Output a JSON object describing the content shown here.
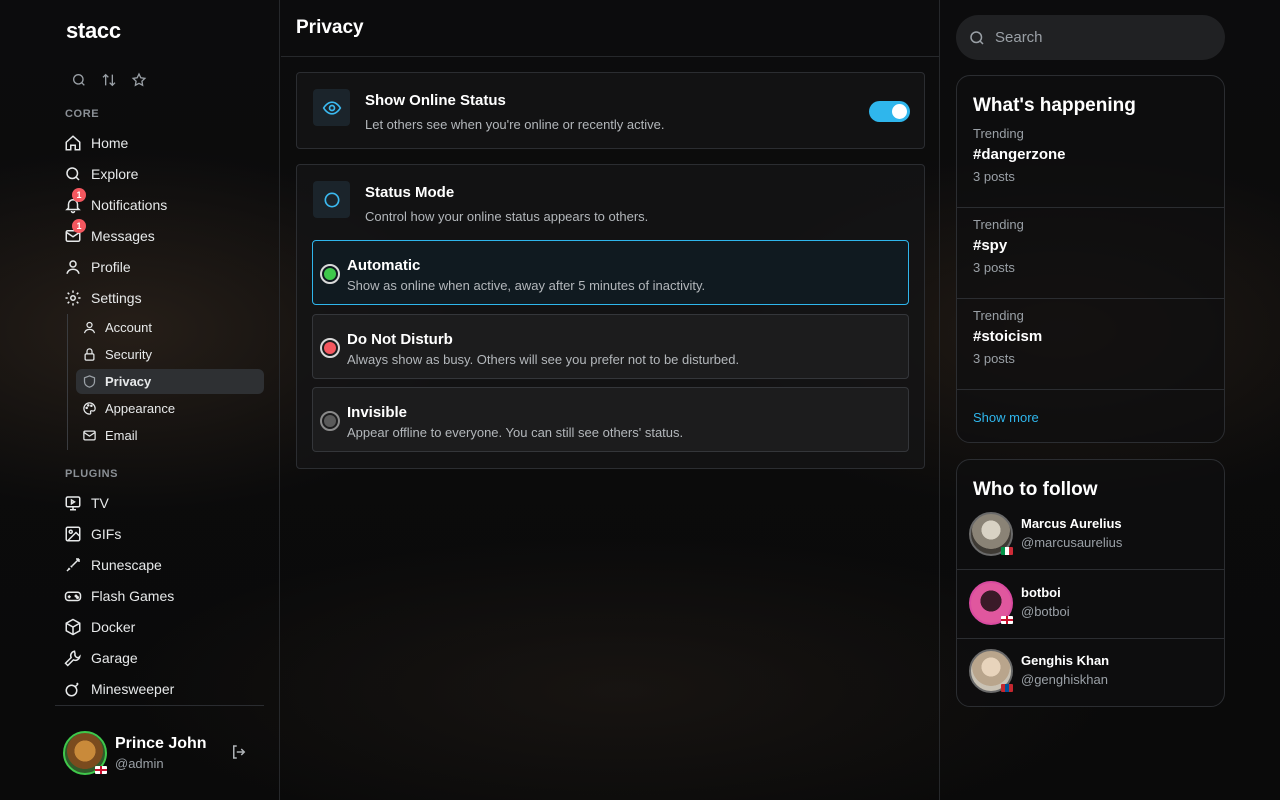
{
  "app": {
    "logo": "stacc"
  },
  "sidebar": {
    "sections": {
      "core": "CORE",
      "plugins": "PLUGINS"
    },
    "core_items": [
      {
        "label": "Home",
        "icon": "home-icon"
      },
      {
        "label": "Explore",
        "icon": "search-icon"
      },
      {
        "label": "Notifications",
        "icon": "bell-icon",
        "badge": "1"
      },
      {
        "label": "Messages",
        "icon": "mail-icon",
        "badge": "1"
      },
      {
        "label": "Profile",
        "icon": "user-icon"
      },
      {
        "label": "Settings",
        "icon": "gear-icon"
      }
    ],
    "settings_items": [
      {
        "label": "Account",
        "icon": "user-icon"
      },
      {
        "label": "Security",
        "icon": "lock-icon"
      },
      {
        "label": "Privacy",
        "icon": "shield-icon",
        "active": true
      },
      {
        "label": "Appearance",
        "icon": "palette-icon"
      },
      {
        "label": "Email",
        "icon": "mail-icon"
      }
    ],
    "plugin_items": [
      {
        "label": "TV",
        "icon": "tv-icon"
      },
      {
        "label": "GIFs",
        "icon": "image-icon"
      },
      {
        "label": "Runescape",
        "icon": "sword-icon"
      },
      {
        "label": "Flash Games",
        "icon": "gamepad-icon"
      },
      {
        "label": "Docker",
        "icon": "box-icon"
      },
      {
        "label": "Garage",
        "icon": "wrench-icon"
      },
      {
        "label": "Minesweeper",
        "icon": "bomb-icon"
      }
    ],
    "user": {
      "name": "Prince John",
      "handle": "@admin"
    }
  },
  "main": {
    "title": "Privacy",
    "online_status": {
      "title": "Show Online Status",
      "description": "Let others see when you're online or recently active.",
      "enabled": true
    },
    "status_mode": {
      "title": "Status Mode",
      "description": "Control how your online status appears to others.",
      "options": [
        {
          "title": "Automatic",
          "description": "Show as online when active, away after 5 minutes of inactivity.",
          "color": "#3fc84b",
          "selected": true
        },
        {
          "title": "Do Not Disturb",
          "description": "Always show as busy. Others will see you prefer not to be disturbed.",
          "color": "#f4575f",
          "selected": false
        },
        {
          "title": "Invisible",
          "description": "Appear offline to everyone. You can still see others' status.",
          "color": "#8a8a8a",
          "selected": false
        }
      ]
    }
  },
  "right": {
    "search_placeholder": "Search",
    "happening": {
      "title": "What's happening",
      "trends": [
        {
          "label": "Trending",
          "tag": "#dangerzone",
          "count": "3 posts"
        },
        {
          "label": "Trending",
          "tag": "#spy",
          "count": "3 posts"
        },
        {
          "label": "Trending",
          "tag": "#stoicism",
          "count": "3 posts"
        }
      ],
      "show_more": "Show more"
    },
    "follow": {
      "title": "Who to follow",
      "users": [
        {
          "name": "Marcus Aurelius",
          "handle": "@marcusaurelius",
          "flag": "italy"
        },
        {
          "name": "botboi",
          "handle": "@botboi",
          "flag": "uk"
        },
        {
          "name": "Genghis Khan",
          "handle": "@genghiskhan",
          "flag": "mongolia"
        }
      ]
    }
  },
  "colors": {
    "accent": "#2fb6ec",
    "badge": "#f4575f",
    "online": "#3fc84b"
  }
}
